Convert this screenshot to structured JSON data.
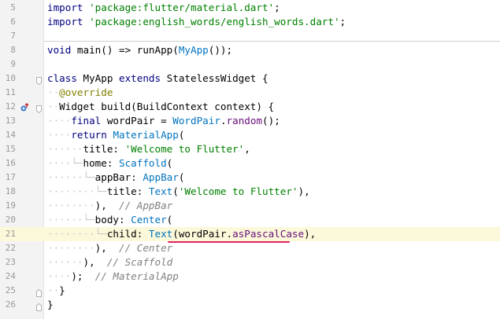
{
  "editor": {
    "lines": [
      {
        "num": "5",
        "segs": [
          [
            "kw",
            "import"
          ],
          [
            "",
            " "
          ],
          [
            "str",
            "'package:flutter/material.dart'"
          ],
          [
            "",
            ";"
          ]
        ]
      },
      {
        "num": "6",
        "segs": [
          [
            "kw",
            "import"
          ],
          [
            "",
            " "
          ],
          [
            "str",
            "'package:english_words/english_words.dart'"
          ],
          [
            "",
            ";"
          ]
        ]
      },
      {
        "num": "7",
        "segs": []
      },
      {
        "num": "8",
        "segs": [
          [
            "kw",
            "void"
          ],
          [
            "",
            " main() => runApp("
          ],
          [
            "cls",
            "MyApp"
          ],
          [
            "",
            "());"
          ]
        ]
      },
      {
        "num": "9",
        "segs": []
      },
      {
        "num": "10",
        "segs": [
          [
            "kw",
            "class"
          ],
          [
            "",
            " MyApp "
          ],
          [
            "kw",
            "extends"
          ],
          [
            "",
            " StatelessWidget {"
          ]
        ]
      },
      {
        "num": "11",
        "segs": [
          [
            "guide",
            "··"
          ],
          [
            "ann",
            "@override"
          ]
        ]
      },
      {
        "num": "12",
        "segs": [
          [
            "guide",
            "··"
          ],
          [
            "",
            "Widget build(BuildContext context) {"
          ]
        ]
      },
      {
        "num": "13",
        "segs": [
          [
            "guide",
            "····"
          ],
          [
            "kw",
            "final"
          ],
          [
            "",
            " wordPair = "
          ],
          [
            "cls",
            "WordPair"
          ],
          [
            "",
            "."
          ],
          [
            "mem",
            "random"
          ],
          [
            "",
            "();"
          ]
        ]
      },
      {
        "num": "14",
        "segs": [
          [
            "guide",
            "····"
          ],
          [
            "kw",
            "return"
          ],
          [
            "",
            " "
          ],
          [
            "cls",
            "MaterialApp"
          ],
          [
            "",
            "("
          ]
        ]
      },
      {
        "num": "15",
        "segs": [
          [
            "guide",
            "······"
          ],
          [
            "",
            "title: "
          ],
          [
            "str",
            "'Welcome to Flutter'"
          ],
          [
            "",
            ","
          ]
        ]
      },
      {
        "num": "16",
        "segs": [
          [
            "guide",
            "····└─"
          ],
          [
            "",
            "home: "
          ],
          [
            "cls",
            "Scaffold"
          ],
          [
            "",
            "("
          ]
        ]
      },
      {
        "num": "17",
        "segs": [
          [
            "guide",
            "······└─"
          ],
          [
            "",
            "appBar: "
          ],
          [
            "cls",
            "AppBar"
          ],
          [
            "",
            "("
          ]
        ]
      },
      {
        "num": "18",
        "segs": [
          [
            "guide",
            "········└─"
          ],
          [
            "",
            "title: "
          ],
          [
            "cls",
            "Text"
          ],
          [
            "",
            "("
          ],
          [
            "str",
            "'Welcome to Flutter'"
          ],
          [
            "",
            "),"
          ]
        ]
      },
      {
        "num": "19",
        "segs": [
          [
            "guide",
            "········"
          ],
          [
            "",
            "),  "
          ],
          [
            "cm",
            "// AppBar"
          ]
        ]
      },
      {
        "num": "20",
        "segs": [
          [
            "guide",
            "······└─"
          ],
          [
            "",
            "body: "
          ],
          [
            "cls",
            "Center"
          ],
          [
            "",
            "("
          ]
        ]
      },
      {
        "num": "21",
        "segs": [
          [
            "guide",
            "········└─"
          ],
          [
            "",
            "child: "
          ],
          [
            "cls",
            "Text"
          ],
          [
            "",
            "(wordPair."
          ],
          [
            "mem",
            "asPascalCase"
          ],
          [
            "",
            "),"
          ]
        ],
        "current": true
      },
      {
        "num": "22",
        "segs": [
          [
            "guide",
            "········"
          ],
          [
            "",
            "),  "
          ],
          [
            "cm",
            "// Center"
          ]
        ]
      },
      {
        "num": "23",
        "segs": [
          [
            "guide",
            "······"
          ],
          [
            "",
            "),  "
          ],
          [
            "cm",
            "// Scaffold"
          ]
        ]
      },
      {
        "num": "24",
        "segs": [
          [
            "guide",
            "····"
          ],
          [
            "",
            ");  "
          ],
          [
            "cm",
            "// MaterialApp"
          ]
        ]
      },
      {
        "num": "25",
        "segs": [
          [
            "guide",
            "··"
          ],
          [
            "",
            "}"
          ]
        ]
      },
      {
        "num": "26",
        "segs": [
          [
            "",
            "}"
          ]
        ]
      }
    ],
    "markers": {
      "override_line": "12"
    },
    "colors": {
      "keyword": "#000080",
      "string": "#008000",
      "class": "#0073bf",
      "comment": "#808080",
      "annotation": "#808000",
      "current_line": "#fcf8da",
      "highlight_underline": "#e0245e"
    }
  }
}
